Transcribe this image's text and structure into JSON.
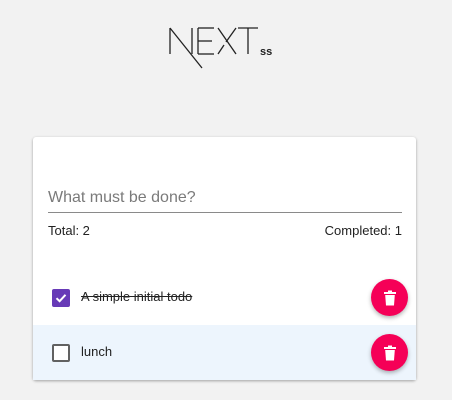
{
  "logo": {
    "text": "NEXT",
    "suffix": "ss"
  },
  "input": {
    "placeholder": "What must be done?",
    "value": ""
  },
  "counts": {
    "total_label": "Total: 2",
    "completed_label": "Completed: 1"
  },
  "todos": [
    {
      "text": "A simple initial todo",
      "completed": true
    },
    {
      "text": "lunch",
      "completed": false
    }
  ],
  "colors": {
    "checkbox_checked": "#673ab7",
    "delete_button": "#f50057",
    "active_row_background": "#edf5fd"
  },
  "icons": {
    "checkbox": "check-icon",
    "delete": "trash-icon"
  }
}
